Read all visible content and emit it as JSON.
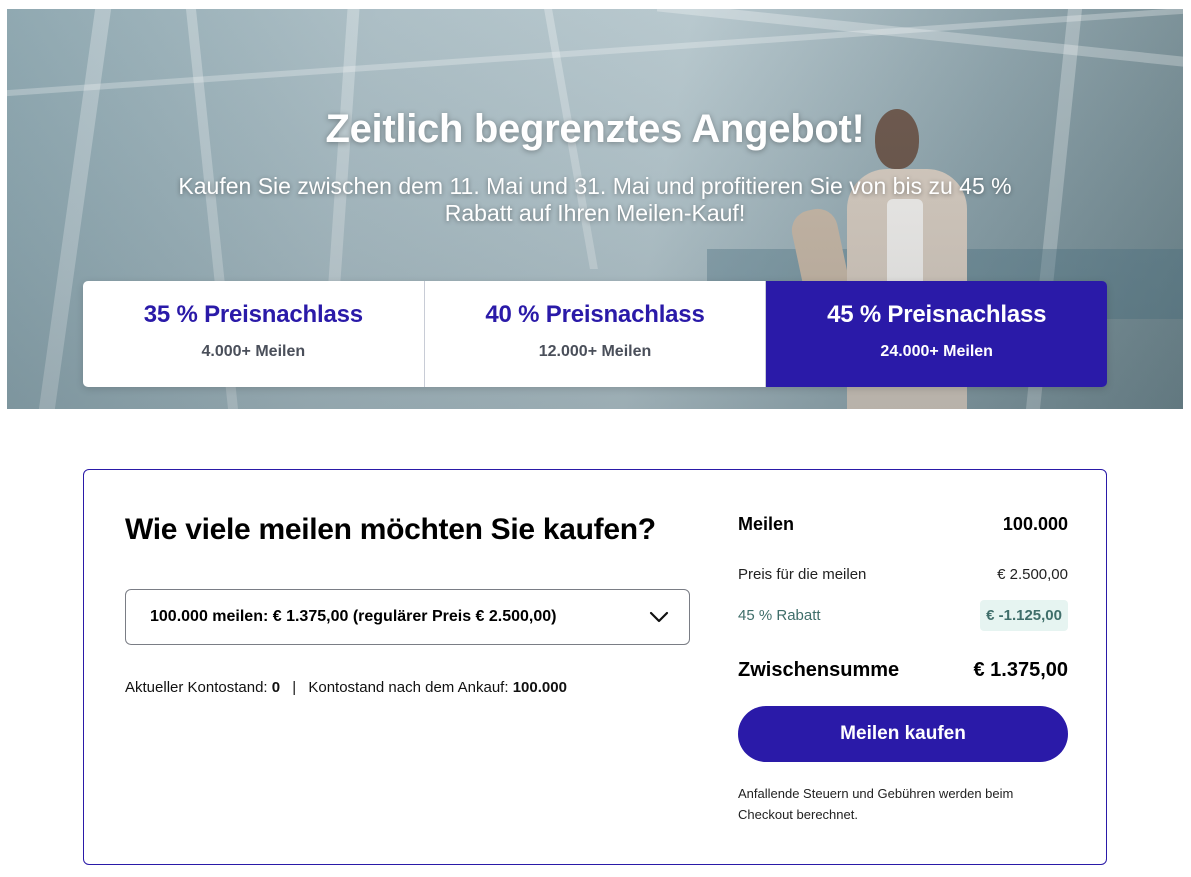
{
  "hero": {
    "title": "Zeitlich begrenztes Angebot!",
    "subtitle": "Kaufen Sie zwischen dem 11. Mai und 31. Mai und profitieren Sie von bis zu 45 % Rabatt auf Ihren Meilen-Kauf!"
  },
  "tiers": [
    {
      "title": "35 % Preisnachlass",
      "miles": "4.000+ Meilen",
      "active": false
    },
    {
      "title": "40 % Preisnachlass",
      "miles": "12.000+ Meilen",
      "active": false
    },
    {
      "title": "45 % Preisnachlass",
      "miles": "24.000+ Meilen",
      "active": true
    }
  ],
  "purchase": {
    "title": "Wie viele meilen möchten Sie kaufen?",
    "select_value": "100.000 meilen: € 1.375,00 (regulärer Preis € 2.500,00)",
    "balance_label": "Aktueller Kontostand:",
    "balance_value": "0",
    "separator": "|",
    "after_label": "Kontostand nach dem Ankauf:",
    "after_value": "100.000"
  },
  "summary": {
    "miles_label": "Meilen",
    "miles_value": "100.000",
    "price_label": "Preis für die meilen",
    "price_value": "€ 2.500,00",
    "discount_label": "45 % Rabatt",
    "discount_value": "€ -1.125,00",
    "subtotal_label": "Zwischensumme",
    "subtotal_value": "€ 1.375,00",
    "buy_label": "Meilen kaufen",
    "tax_note": "Anfallende Steuern und Gebühren werden beim Checkout berechnet."
  },
  "colors": {
    "brand": "#2a1aa8",
    "discount_bg": "#e6f4f1",
    "discount_text": "#3f6e6a"
  }
}
